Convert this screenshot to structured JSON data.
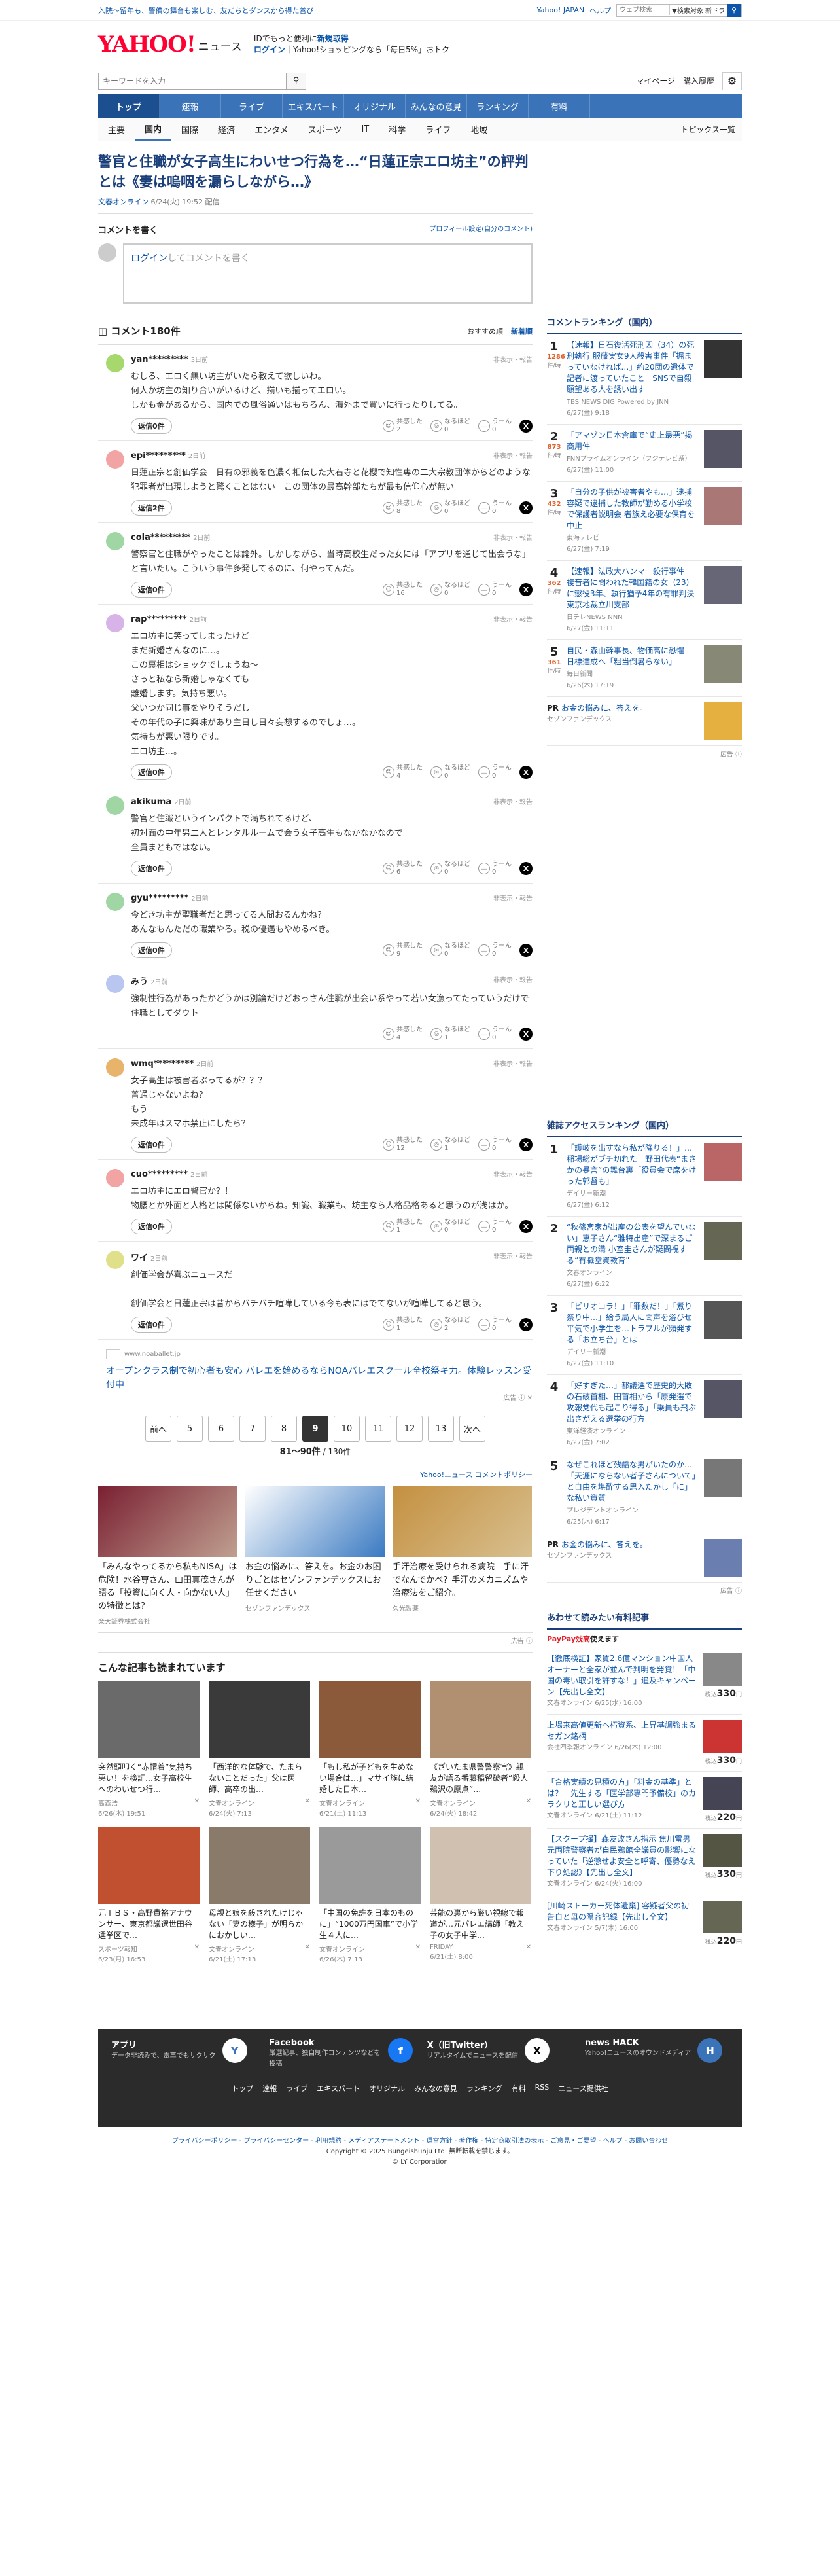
{
  "topbar": {
    "left": "入院〜留年も、警備の舞台も楽しむ、友だちとダンスから得た善び",
    "yj": "Yahoo! JAPAN",
    "help": "ヘルプ",
    "search_placeholder": "ウェブ検索",
    "search_select": "▼検索対象 新ドラ"
  },
  "header": {
    "logo": "YAHOO!",
    "logo_sub": "ニュース",
    "logo_j": "JAPAN",
    "promo1": "IDでもっと便利に",
    "promo1b": "新規取得",
    "promo2a": "ログイン",
    "promo2b": "Yahoo!ショッピングなら「毎日5%」おトク"
  },
  "search": {
    "placeholder": "キーワードを入力",
    "mypage": "マイページ",
    "history": "購入履歴"
  },
  "nav1": [
    "トップ",
    "速報",
    "ライブ",
    "エキスパート",
    "オリジナル",
    "みんなの意見",
    "ランキング",
    "有料"
  ],
  "nav2": [
    "主要",
    "国内",
    "国際",
    "経済",
    "エンタメ",
    "スポーツ",
    "IT",
    "科学",
    "ライフ",
    "地域"
  ],
  "nav2_right": "トピックス一覧",
  "article": {
    "title": "警官と住職が女子高生にわいせつ行為を…“日蓮正宗エロ坊主”の評判とは《妻は嗚咽を漏らしながら…》",
    "source": "文春オンライン",
    "date": "6/24(火) 19:52 配信"
  },
  "comment_write": {
    "title": "コメントを書く",
    "profile": "プロフィール設定(自分のコメント)",
    "login": "ログイン",
    "placeholder": "してコメントを書く"
  },
  "comments_head": {
    "title": "コメント180件",
    "sort1": "おすすめ順",
    "sort2": "新着順"
  },
  "comments": [
    {
      "user": "yan*********",
      "time": "3日前",
      "report": "非表示・報告",
      "text": "むしろ、エロく無い坊主がいたら教えて欲しいわ。\n何人か坊主の知り合いがいるけど、揃いも揃ってエロい。\nしかも金があるから、国内での風俗通いはもちろん、海外まで買いに行ったりしてる。",
      "reply": "返信0件",
      "a1": "共感した",
      "c1": "2",
      "a2": "なるほど",
      "c2": "0",
      "a3": "うーん",
      "c3": "0",
      "col": "#a6d86e"
    },
    {
      "user": "epi*********",
      "time": "2日前",
      "report": "非表示・報告",
      "text": "日蓮正宗と創価学会　日有の邪義を色濃く相伝した大石寺と花櫻で知性専の二大宗教団体からどのような犯罪者が出現しようと驚くことはない　この団体の最高幹部たちが最も信仰心が無い",
      "reply": "返信2件",
      "a1": "共感した",
      "c1": "8",
      "a2": "なるほど",
      "c2": "0",
      "a3": "うーん",
      "c3": "0",
      "col": "#f2a3a3"
    },
    {
      "user": "cola*********",
      "time": "2日前",
      "report": "非表示・報告",
      "text": "警察官と住職がやったことは論外。しかしながら、当時高校生だった女には「アプリを通じて出会うな」と言いたい。こういう事件多発してるのに、何やってんだ。",
      "reply": "返信0件",
      "a1": "共感した",
      "c1": "16",
      "a2": "なるほど",
      "c2": "0",
      "a3": "うーん",
      "c3": "0",
      "col": "#9fd6a3"
    },
    {
      "user": "rap*********",
      "time": "2日前",
      "report": "非表示・報告",
      "text": "エロ坊主に笑ってしまったけど\nまだ新婚さんなのに…。\nこの裏相はショックでしょうね～\nさっと私なら新婚しゃなくても\n離婚します。気持ち悪い。\n父いつか同じ事をやりそうだし\nその年代の子に興味があり主日し日々妄想するのでしょ…。\n気持ちが悪い限りです。\nエロ坊主…。",
      "reply": "返信0件",
      "a1": "共感した",
      "c1": "4",
      "a2": "なるほど",
      "c2": "0",
      "a3": "うーん",
      "c3": "0",
      "col": "#d8b3e8"
    },
    {
      "user": "akikuma",
      "time": "2日前",
      "report": "非表示・報告",
      "text": "警官と住職というインパクトで満ちれてるけど、\n初対面の中年男二人とレンタルルームで会う女子高生もなかなかなので\n全員まともではない。",
      "reply": "返信0件",
      "a1": "共感した",
      "c1": "6",
      "a2": "なるほど",
      "c2": "0",
      "a3": "うーん",
      "c3": "0",
      "col": "#9fd6a3"
    },
    {
      "user": "gyu*********",
      "time": "2日前",
      "report": "非表示・報告",
      "text": "今どき坊主が聖職者だと思ってる人間おるんかね？\nあんなもんただの職業やろ。税の優遇もやめるべき。",
      "reply": "返信0件",
      "a1": "共感した",
      "c1": "9",
      "a2": "なるほど",
      "c2": "0",
      "a3": "うーん",
      "c3": "0",
      "col": "#9fd6a3"
    },
    {
      "user": "みう",
      "time": "2日前",
      "report": "非表示・報告",
      "text": "強制性行為があったかどうかは別論だけどおっさん住職が出会い系やって若い女漁ってたっていうだけで住職としてダウト",
      "reply": "",
      "a1": "共感した",
      "c1": "4",
      "a2": "なるほど",
      "c2": "1",
      "a3": "うーん",
      "c3": "0",
      "col": "#b9c6f0"
    },
    {
      "user": "wmq*********",
      "time": "2日前",
      "report": "非表示・報告",
      "text": "女子高生は被害者ぶってるが？？？\n普通じゃないよね？\nもう\n未成年はスマホ禁止にしたら？",
      "reply": "返信0件",
      "a1": "共感した",
      "c1": "12",
      "a2": "なるほど",
      "c2": "1",
      "a3": "うーん",
      "c3": "0",
      "col": "#e8b36a"
    },
    {
      "user": "cuo*********",
      "time": "2日前",
      "report": "非表示・報告",
      "text": "エロ坊主にエロ警官か？！\n物腰とか外面と人格とは関係ないからね。知識、職業も、坊主なら人格品格あると思うのが浅はか。",
      "reply": "返信0件",
      "a1": "共感した",
      "c1": "1",
      "a2": "なるほど",
      "c2": "0",
      "a3": "うーん",
      "c3": "0",
      "col": "#f2a3a3"
    },
    {
      "user": "ワイ",
      "time": "2日前",
      "report": "非表示・報告",
      "text": "創価学会が喜ぶニュースだ\n\n創価学会と日蓮正宗は昔からバチバチ喧嘩している今も表にはでてないが喧嘩してると思う。",
      "reply": "返信0件",
      "a1": "共感した",
      "c1": "1",
      "a2": "なるほど",
      "c2": "2",
      "a3": "うーん",
      "c3": "0",
      "col": "#e0e08a"
    }
  ],
  "inline_ad": {
    "domain": "www.noaballet.jp",
    "text": "オープンクラス制で初心者も安心 バレエを始めるならNOAバレエスクール全校祭キ力。体験レッスン受付中",
    "label": "広告"
  },
  "pagination": {
    "prev": "前へ",
    "pages": [
      "5",
      "6",
      "7",
      "8",
      "9",
      "10",
      "11",
      "12",
      "13"
    ],
    "next": "次へ",
    "current": "9",
    "range": "81〜90件",
    "total": "/ 130件"
  },
  "policy": "Yahoo!ニュース コメントポリシー",
  "ads3": [
    {
      "text": "「みんなやってるから私もNISA」は危険！水谷専さん、山田真茂さんが語る「投資に向く人・向かない人」の特徴とは？",
      "sp": "楽天証券株式会社",
      "c1": "#7a2032",
      "c2": "#c0a090"
    },
    {
      "text": "お金の悩みに、答えを。お金のお困りごとはセゾンファンデックスにお任せください",
      "sp": "セゾンファンデックス",
      "c1": "#fff",
      "c2": "#3a7ac2"
    },
    {
      "text": "手汗治療を受けられる病院｜手に汗でなんでかべ？手汗のメカニズムや治療法をご紹介。",
      "sp": "久光製薬",
      "c1": "#c49040",
      "c2": "#d8c090"
    }
  ],
  "ads3_label": "広告",
  "also": {
    "title": "こんな記事も読まれています",
    "items": [
      {
        "text": "突然頭叩く“赤帽着”気持ち悪い！を検証…女子高校生へのわいせつ行…",
        "src": "高森浩",
        "date": "6/26(木) 19:51",
        "c": "#6a6a6a"
      },
      {
        "text": "「西洋的な体験で、たまらないことだった」父は医師、高卒の出…",
        "src": "文春オンライン",
        "date": "6/24(火) 7:13",
        "c": "#3a3a3a"
      },
      {
        "text": "「もし私が子どもを生めない場合は…」マサイ族に結婚した日本…",
        "src": "文春オンライン",
        "date": "6/21(土) 11:13",
        "c": "#8a5a3a"
      },
      {
        "text": "《ざいたま県警警察官》親友が語る番藤稲留破者“殺人鵜沢の原点”…",
        "src": "文春オンライン",
        "date": "6/24(火) 18:42",
        "c": "#b09070"
      },
      {
        "text": "元ＴＢＳ・高野貴裕アナウンサー、東京都議選世田谷選挙区で…",
        "src": "スポーツ報知",
        "date": "6/23(月) 16:53",
        "c": "#c05030"
      },
      {
        "text": "母親と娘を殺されたけじゃない「妻の様子」が明らかにおかしい…",
        "src": "文春オンライン",
        "date": "6/21(土) 17:13",
        "c": "#8a7a6a"
      },
      {
        "text": "「中国の免許を日本のものに」“1000万円国車”で小学生４人に…",
        "src": "文春オンライン",
        "date": "6/26(木) 7:13",
        "c": "#9a9a9a"
      },
      {
        "text": "芸能の裏から厳い視線で報道が…元パレエ講師「教え子の女子中学…",
        "src": "FRIDAY",
        "date": "6/21(土) 8:00",
        "c": "#d0c0b0"
      }
    ]
  },
  "ranking": {
    "title": "コメントランキング（国内）",
    "items": [
      {
        "n": "1",
        "cnt": "1286",
        "unit": "件/時",
        "text": "【速報】日石復活死刑囚（34）の死刑執行 服藤実女9人殺害事件「掘まっていなければ…」約20団の遺体で記者に渡っていたこと　SNSで自殺願望ある人を誘い出す",
        "src": "TBS NEWS DIG Powered by JNN",
        "date": "6/27(金) 9:18",
        "c": "#333"
      },
      {
        "n": "2",
        "cnt": "873",
        "unit": "件/時",
        "text": "「アマゾン日本倉庫で“史上最悪”掲商用件",
        "src": "FNNプライムオンライン（フジテレビ系）",
        "date": "6/27(金) 11:00",
        "c": "#556"
      },
      {
        "n": "3",
        "cnt": "432",
        "unit": "件/時",
        "text": "「自分の子供が被害者やも…」逮捕容疑で逮捕した教師が勤める小学校で保護者説明会 者族え必要な保育を中止",
        "src": "東海テレビ",
        "date": "6/27(金) 7:19",
        "c": "#a77"
      },
      {
        "n": "4",
        "cnt": "362",
        "unit": "件/時",
        "text": "【速報】法政大ハンマー殺行事件　複音者に問われた韓国籍の女（23）に懲役3年、執行猶予4年の有罪判決　東京地裁立川支部",
        "src": "日テレNEWS NNN",
        "date": "6/27(金) 11:11",
        "c": "#667"
      },
      {
        "n": "5",
        "cnt": "361",
        "unit": "件/時",
        "text": "自民・森山幹事長、物価高に恐懼　日標達成へ「粗当倒暑らない」",
        "src": "毎日新聞",
        "date": "6/26(木) 17:19",
        "c": "#887"
      }
    ],
    "pr": {
      "label": "PR",
      "text": "お金の悩みに、答えを。",
      "sp": "セゾンファンデックス"
    },
    "ad": "広告"
  },
  "zasshi": {
    "title": "雑誌アクセスランキング（国内）",
    "items": [
      {
        "n": "1",
        "text": "「護岐を出すなら私が降りる！」…稲場総がブチ切れた　野田代表“まさかの暴言”の舞台裏「役員会で席をけった郭督も」",
        "src": "デイリー新潮",
        "date": "6/27(金) 6:12",
        "c": "#b66"
      },
      {
        "n": "2",
        "text": "“秋篠宮家が出産の公表を望んでいない」恵子さん“雅特出産”で深まるご両親との溝 小室圭さんが疑問視する“有職堂資教育”",
        "src": "文春オンライン",
        "date": "6/27(金) 6:22",
        "c": "#665"
      },
      {
        "n": "3",
        "text": "「ピリオコラ！」「罪数だ！」「煮り祭り中…」給う局人に聞声を浴びせ平気で小学生を…トラブルが頻発する「お立ち台」とは",
        "src": "デイリー新潮",
        "date": "6/27(金) 11:10",
        "c": "#555"
      },
      {
        "n": "4",
        "text": "「好すぎた…」都議選で歴史的大敗の石破首相、田首相から「原発選で攻報党代も起こり得る」「乗員も飛ぶ出さがえる選挙の行方",
        "src": "東洋経済オンライン",
        "date": "6/27(金) 7:02",
        "c": "#556"
      },
      {
        "n": "5",
        "text": "なぜこれほど残酷な男がいたのか…「天涯にならない者子さんについて」と自由を堪酔する思入たかし「に」な私い資質",
        "src": "プレジデントオンライン",
        "date": "6/25(水) 6:17",
        "c": "#777"
      }
    ],
    "pr": {
      "label": "PR",
      "text": "お金の悩みに、答えを。",
      "sp": "セゾンファンデックス"
    },
    "ad": "広告"
  },
  "paid": {
    "title": "あわせて読みたい有料記事",
    "badge": "PayPay残高",
    "badge2": "使えます",
    "items": [
      {
        "text": "【徹底検証】家賃2.6億マンション中国人オーナーと全家が並んで判明を発覚！「中国の毒い取引を許すな！」追及キャンペーン【先出し全文】",
        "src": "文春オンライン",
        "date": "6/25(水) 16:00",
        "pre": "税込",
        "price": "330",
        "unit": "円",
        "c": "#888"
      },
      {
        "text": "上場来高値更新ヘ朽資系、上昇基調強まるセガン銘柄",
        "src": "会社四季報オンライン",
        "date": "6/26(木) 12:00",
        "pre": "税込",
        "price": "330",
        "unit": "円",
        "c": "#c33"
      },
      {
        "text": "「合格実績の見積の方」「料金の基準」とは？　先生する「医学部専門予備校」のカラクリと正しい選び方",
        "src": "文春オンライン",
        "date": "6/21(土) 11:12",
        "pre": "税込",
        "price": "220",
        "unit": "円",
        "c": "#445"
      },
      {
        "text": "【スクープ撮】森友改さん指示 焦川雷男元両院警察者が自民鵜館全議員の影響になっていた「逆懲せよ安全と呼寄、優勢なえ下り処認》【先出し全文】",
        "src": "文春オンライン",
        "date": "6/24(火) 16:00",
        "pre": "税込",
        "price": "330",
        "unit": "円",
        "c": "#554"
      },
      {
        "text": "[川崎ストーカー死体遺棄] 容疑者父の初告自と母の隠容記録【先出し全文】",
        "src": "文春オンライン",
        "date": "5/7(木) 16:00",
        "pre": "税込",
        "price": "220",
        "unit": "円",
        "c": "#665"
      }
    ]
  },
  "footer": {
    "apps": [
      {
        "name": "アプリ",
        "desc": "データ非読みで、電車でもサクサク",
        "icon": "Y",
        "c": "#fff",
        "fc": "#3b73b9"
      },
      {
        "name": "Facebook",
        "desc": "厳選記事、独自制作コンテンツなどを投稿",
        "icon": "f",
        "c": "#1877f2",
        "fc": "#fff"
      },
      {
        "name": "X（旧Twitter）",
        "desc": "リアルタイムでニュースを配信",
        "icon": "X",
        "c": "#fff",
        "fc": "#000"
      },
      {
        "name": "news HACK",
        "desc": "Yahoo!ニュースのオウンドメディア",
        "icon": "H",
        "c": "#3b73b9",
        "fc": "#fff"
      }
    ],
    "links": [
      "トップ",
      "速報",
      "ライブ",
      "エキスパート",
      "オリジナル",
      "みんなの意見",
      "ランキング",
      "有料",
      "RSS",
      "ニュース提供社"
    ],
    "legal": "プライバシーポリシー - プライバシーセンター - 利用規約 - メディアステートメント - 運営方針 - 著作権 - 特定商取引法の表示 - ご意見・ご要望 - ヘルプ - お問い合わせ",
    "copy": "Copyright © 2025 Bungeishunju Ltd. 無断転載を禁じます。",
    "copy2": "© LY Corporation"
  }
}
